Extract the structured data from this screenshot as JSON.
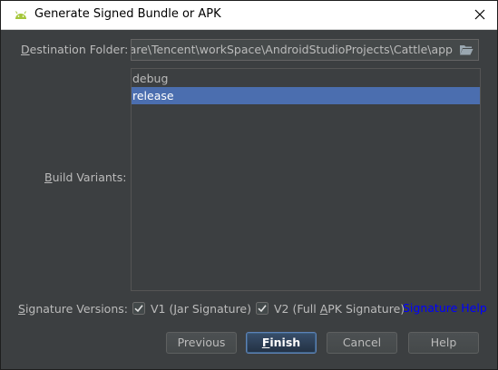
{
  "window": {
    "title": "Generate Signed Bundle or APK"
  },
  "destination": {
    "label_first": "D",
    "label_rest": "estination Folder:",
    "value": "ware\\Tencent\\workSpace\\AndroidStudioProjects\\Cattle\\app"
  },
  "build_variants": {
    "label_first": "B",
    "label_rest": "uild Variants:",
    "items": [
      {
        "label": "debug",
        "selected": false
      },
      {
        "label": "release",
        "selected": true
      }
    ]
  },
  "signature": {
    "label_first": "S",
    "label_rest": "ignature Versions:",
    "v1": {
      "pre": "V1 (",
      "mnemonic": "J",
      "post": "ar Signature)",
      "checked": true
    },
    "v2": {
      "pre": "V2 (Full ",
      "mnemonic": "A",
      "post": "PK Signature)",
      "checked": true
    },
    "help_link": "Signature Help"
  },
  "buttons": {
    "previous": "Previous",
    "finish_first": "F",
    "finish_rest": "inish",
    "cancel": "Cancel",
    "help": "Help"
  },
  "colors": {
    "background": "#3c3f41",
    "selection": "#4b6eaf",
    "link": "#0000ff",
    "android_green": "#a4c639"
  }
}
